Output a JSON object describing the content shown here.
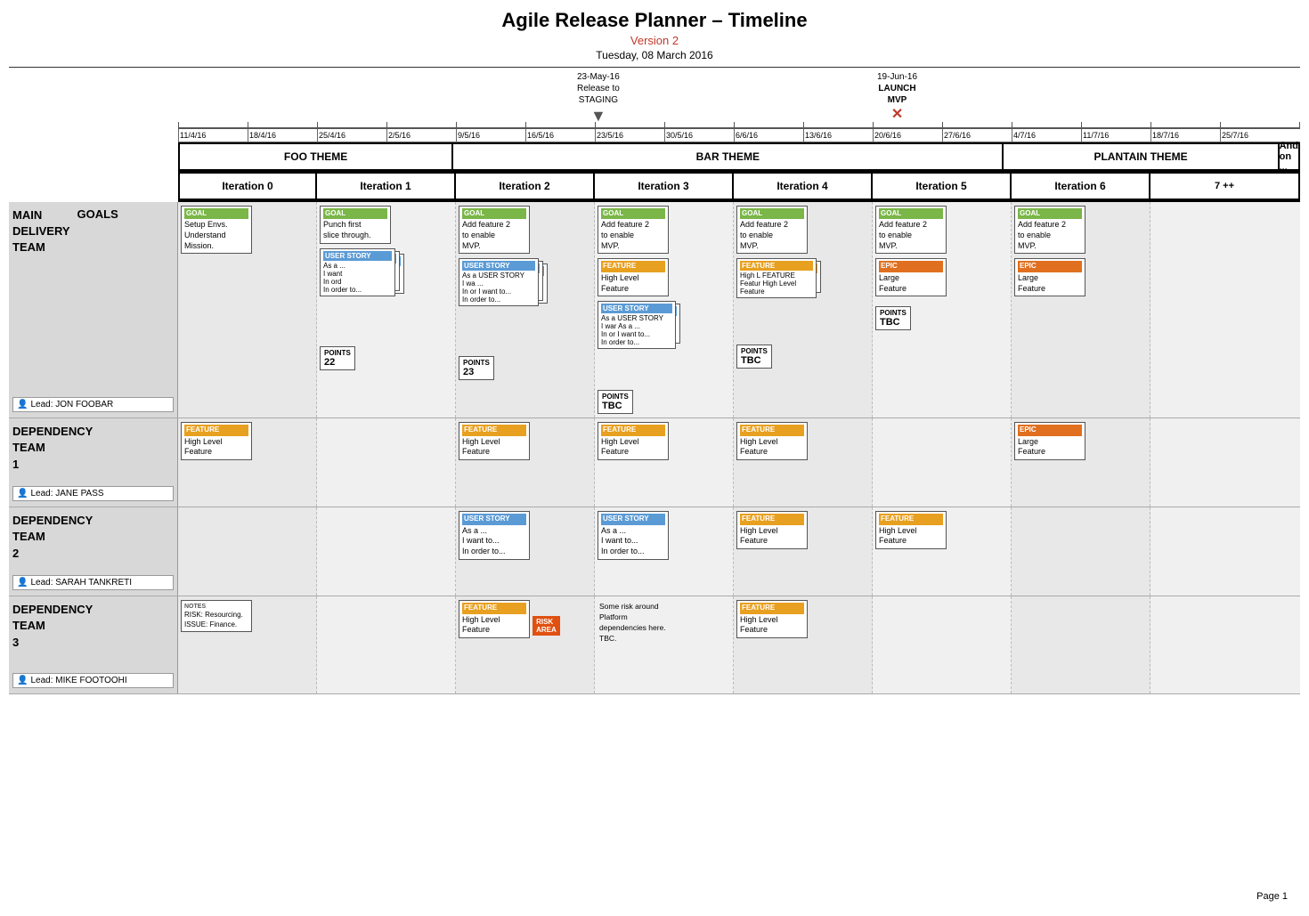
{
  "header": {
    "title": "Agile Release Planner – Timeline",
    "version": "Version 2",
    "date": "Tuesday, 08 March 2016",
    "page_number": "Page 1"
  },
  "milestones": [
    {
      "id": "staging",
      "label": "23-May-16\nRelease to\nSTAGING",
      "arrow": "▼",
      "color": "#c0392b"
    },
    {
      "id": "mvp",
      "label": "19-Jun-16\nLAUNCH\nMVP",
      "marker": "✕",
      "color": "#c0392b"
    }
  ],
  "dates": [
    "11/4/16",
    "18/4/16",
    "25/4/16",
    "2/5/16",
    "9/5/16",
    "16/5/16",
    "23/5/16",
    "30/5/16",
    "6/6/16",
    "13/6/16",
    "20/6/16",
    "27/6/16",
    "4/7/16",
    "11/7/16",
    "18/7/16",
    "25/7/16"
  ],
  "themes": [
    {
      "id": "foo",
      "label": "FOO THEME",
      "cols": 2
    },
    {
      "id": "bar",
      "label": "BAR THEME",
      "cols": 4
    },
    {
      "id": "plantain",
      "label": "PLANTAIN THEME",
      "cols": 2
    },
    {
      "id": "andon",
      "label": "And on ...",
      "cols": 1
    }
  ],
  "iterations": [
    {
      "id": "iter0",
      "label": "Iteration 0"
    },
    {
      "id": "iter1",
      "label": "Iteration 1"
    },
    {
      "id": "iter2",
      "label": "Iteration 2"
    },
    {
      "id": "iter3",
      "label": "Iteration 3"
    },
    {
      "id": "iter4",
      "label": "Iteration 4"
    },
    {
      "id": "iter5",
      "label": "Iteration 5"
    },
    {
      "id": "iter6",
      "label": "Iteration 6"
    },
    {
      "id": "iter7",
      "label": "7 ++"
    }
  ],
  "teams": [
    {
      "id": "main",
      "name": "MAIN\nDELIVERY\nTEAM",
      "goals_label": "GOALS",
      "lead": "Lead: JON FOOBAR",
      "cols": [
        {
          "iter": 0,
          "cards": [
            {
              "type": "goal",
              "text": "Setup Envs.\nUnderstand\nMission."
            }
          ]
        },
        {
          "iter": 1,
          "cards": [
            {
              "type": "goal",
              "text": "Punch first\nslice through."
            },
            {
              "type": "user_story",
              "stacked": true,
              "lines": [
                "As a ...",
                "I want USER STORY",
                "In ord  As a ...",
                "       I want to...",
                "       In order to..."
              ]
            }
          ],
          "points": "22"
        },
        {
          "iter": 2,
          "cards": [
            {
              "type": "goal",
              "text": "Add feature 2\nto enable\nMVP."
            },
            {
              "type": "user_story",
              "stacked": true,
              "lines": [
                "As a USER STORY",
                "I wa  As a USER STORY",
                "In or  As a ...",
                "      I want to...",
                "      In order to..."
              ]
            }
          ],
          "points": "23"
        },
        {
          "iter": 3,
          "cards": [
            {
              "type": "goal",
              "text": "Add feature 2\nto enable\nMVP."
            },
            {
              "type": "feature",
              "text": "High Level\nFeature"
            },
            {
              "type": "user_story",
              "stacked": true,
              "lines": [
                "As a  USER STORY",
                "I war  As a ...",
                "In or  I want to...",
                "       In order to..."
              ]
            }
          ],
          "points": "TBC"
        },
        {
          "iter": 4,
          "cards": [
            {
              "type": "goal",
              "text": "Add feature 2\nto enable\nMVP."
            },
            {
              "type": "feature",
              "stacked": true,
              "text": "High L  FEATURE\nFeatur  High Level\n        Feature"
            }
          ],
          "points": "TBC"
        },
        {
          "iter": 5,
          "cards": [
            {
              "type": "goal",
              "text": "Add feature 2\nto enable\nMVP."
            },
            {
              "type": "epic",
              "text": "Large\nFeature"
            }
          ],
          "points": "TBC"
        },
        {
          "iter": 6,
          "cards": [
            {
              "type": "goal",
              "text": "Add feature 2\nto enable\nMVP."
            },
            {
              "type": "epic",
              "text": "Large\nFeature"
            }
          ]
        }
      ]
    },
    {
      "id": "dep1",
      "name": "DEPENDENCY\nTEAM\n1",
      "lead": "Lead: JANE PASS",
      "cols": [
        {
          "iter": 0,
          "cards": [
            {
              "type": "feature",
              "text": "High Level\nFeature"
            }
          ]
        },
        {
          "iter": 1,
          "cards": []
        },
        {
          "iter": 2,
          "cards": [
            {
              "type": "feature",
              "text": "High Level\nFeature"
            }
          ]
        },
        {
          "iter": 3,
          "cards": [
            {
              "type": "feature",
              "text": "High Level\nFeature"
            }
          ]
        },
        {
          "iter": 4,
          "cards": [
            {
              "type": "feature",
              "text": "High Level\nFeature"
            }
          ]
        },
        {
          "iter": 5,
          "cards": []
        },
        {
          "iter": 6,
          "cards": [
            {
              "type": "epic",
              "text": "Large\nFeature"
            }
          ]
        }
      ]
    },
    {
      "id": "dep2",
      "name": "DEPENDENCY\nTEAM\n2",
      "lead": "Lead: SARAH TANKRETI",
      "cols": [
        {
          "iter": 0,
          "cards": []
        },
        {
          "iter": 1,
          "cards": []
        },
        {
          "iter": 2,
          "cards": [
            {
              "type": "user_story",
              "lines": [
                "As a ...",
                "I want to...",
                "In order to..."
              ]
            }
          ]
        },
        {
          "iter": 3,
          "cards": [
            {
              "type": "user_story",
              "lines": [
                "As a ...",
                "I want to...",
                "In order to..."
              ]
            }
          ]
        },
        {
          "iter": 4,
          "cards": [
            {
              "type": "feature",
              "text": "High Level\nFeature"
            }
          ]
        },
        {
          "iter": 5,
          "cards": [
            {
              "type": "feature",
              "text": "High Level\nFeature"
            }
          ]
        },
        {
          "iter": 6,
          "cards": []
        }
      ]
    },
    {
      "id": "dep3",
      "name": "DEPENDENCY\nTEAM\n3",
      "lead": "Lead: MIKE FOOTOOHI",
      "cols": [
        {
          "iter": 0,
          "cards": [
            {
              "type": "notes",
              "text": "RISK: Resourcing.\nISSUE: Finance."
            }
          ]
        },
        {
          "iter": 1,
          "cards": []
        },
        {
          "iter": 2,
          "cards": [
            {
              "type": "feature",
              "text": "High Level\nFeature"
            },
            {
              "type": "risk",
              "text": "RISK\nAREA"
            }
          ]
        },
        {
          "iter": 3,
          "cards": [
            {
              "type": "note_text",
              "text": "Some risk around\nPlatform\ndependencies here.\nTBC."
            }
          ]
        },
        {
          "iter": 4,
          "cards": [
            {
              "type": "feature",
              "text": "High Level\nFeature"
            }
          ]
        },
        {
          "iter": 5,
          "cards": []
        },
        {
          "iter": 6,
          "cards": []
        }
      ]
    }
  ],
  "labels": {
    "goal": "GOAL",
    "feature": "FEATURE",
    "user_story": "USER STORY",
    "epic": "EPIC",
    "notes": "NOTES",
    "points": "POINTS"
  }
}
